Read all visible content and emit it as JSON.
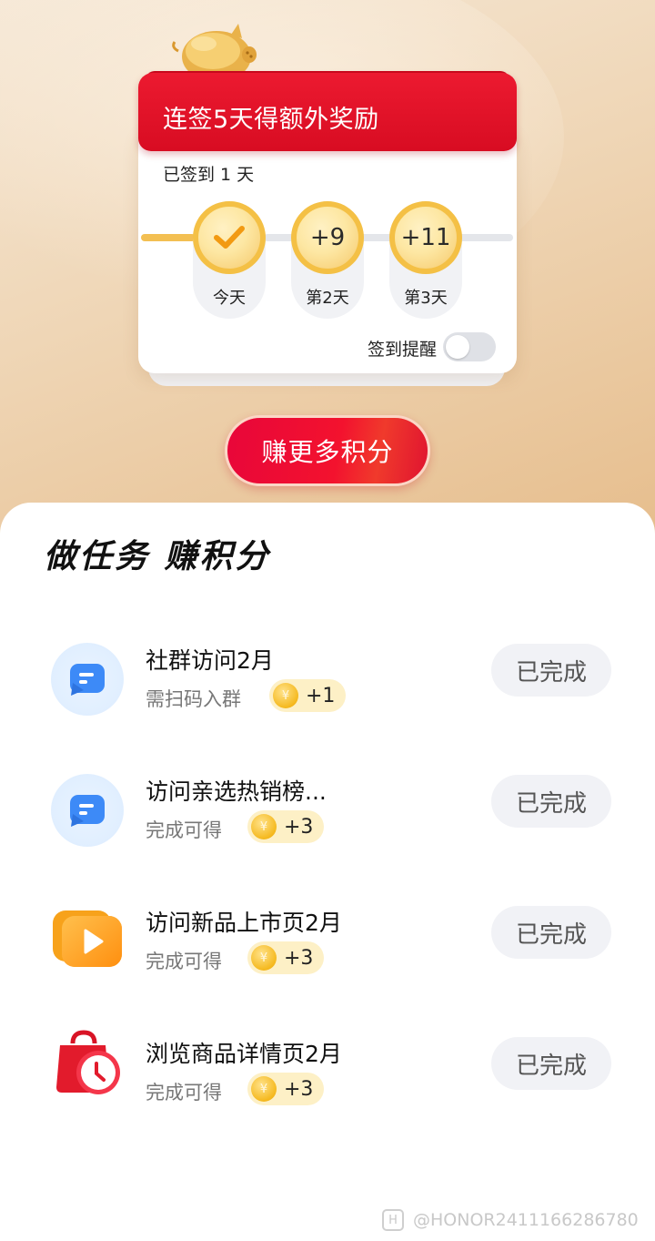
{
  "signin": {
    "banner_title": "连签5天得额外奖励",
    "signed_status": "已签到 1 天",
    "days": [
      {
        "label": "今天",
        "reward": "",
        "checked": true
      },
      {
        "label": "第2天",
        "reward": "+9",
        "checked": false
      },
      {
        "label": "第3天",
        "reward": "+11",
        "checked": false
      }
    ],
    "reminder_label": "签到提醒",
    "reminder_on": false,
    "earn_more_button": "赚更多积分"
  },
  "tasks": {
    "title": "做任务 赚积分",
    "items": [
      {
        "name": "社群访问2月",
        "subtitle": "需扫码入群",
        "reward": "+1",
        "status": "已完成",
        "icon": "chat-bubble-icon"
      },
      {
        "name": "访问亲选热销榜...",
        "subtitle": "完成可得",
        "reward": "+3",
        "status": "已完成",
        "icon": "chat-bubble-icon"
      },
      {
        "name": "访问新品上市页2月",
        "subtitle": "完成可得",
        "reward": "+3",
        "status": "已完成",
        "icon": "video-play-icon"
      },
      {
        "name": "浏览商品详情页2月",
        "subtitle": "完成可得",
        "reward": "+3",
        "status": "已完成",
        "icon": "shopping-bag-clock-icon"
      }
    ],
    "coin_symbol": "¥"
  },
  "watermark": {
    "text": "@HONOR2411166286780"
  },
  "colors": {
    "brand_red": "#e8102e",
    "gold": "#f4c045",
    "done_bg": "#f1f2f6"
  }
}
